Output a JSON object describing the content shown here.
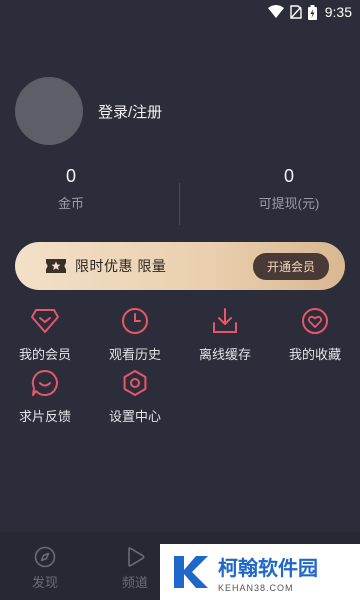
{
  "status_bar": {
    "time": "9:35"
  },
  "profile": {
    "login_label": "登录/注册"
  },
  "stats": {
    "coins": {
      "value": "0",
      "label": "金币"
    },
    "withdrawable": {
      "value": "0",
      "label": "可提现(元)"
    }
  },
  "vip_banner": {
    "text": "限时优惠 限量",
    "button": "开通会员"
  },
  "menu": [
    {
      "label": "我的会员",
      "icon": "diamond-icon"
    },
    {
      "label": "观看历史",
      "icon": "clock-icon"
    },
    {
      "label": "离线缓存",
      "icon": "download-icon"
    },
    {
      "label": "我的收藏",
      "icon": "heart-icon"
    },
    {
      "label": "求片反馈",
      "icon": "chat-icon"
    },
    {
      "label": "设置中心",
      "icon": "settings-icon"
    }
  ],
  "tabbar": [
    {
      "label": "发现",
      "icon": "compass-icon"
    },
    {
      "label": "频道",
      "icon": "play-icon"
    }
  ],
  "watermark": {
    "title": "柯翰软件园",
    "subtitle": "KEHAN38.COM"
  },
  "colors": {
    "accent": "#e8566a",
    "background": "#2b2d3a",
    "vip_gold": "#e9cfae"
  }
}
